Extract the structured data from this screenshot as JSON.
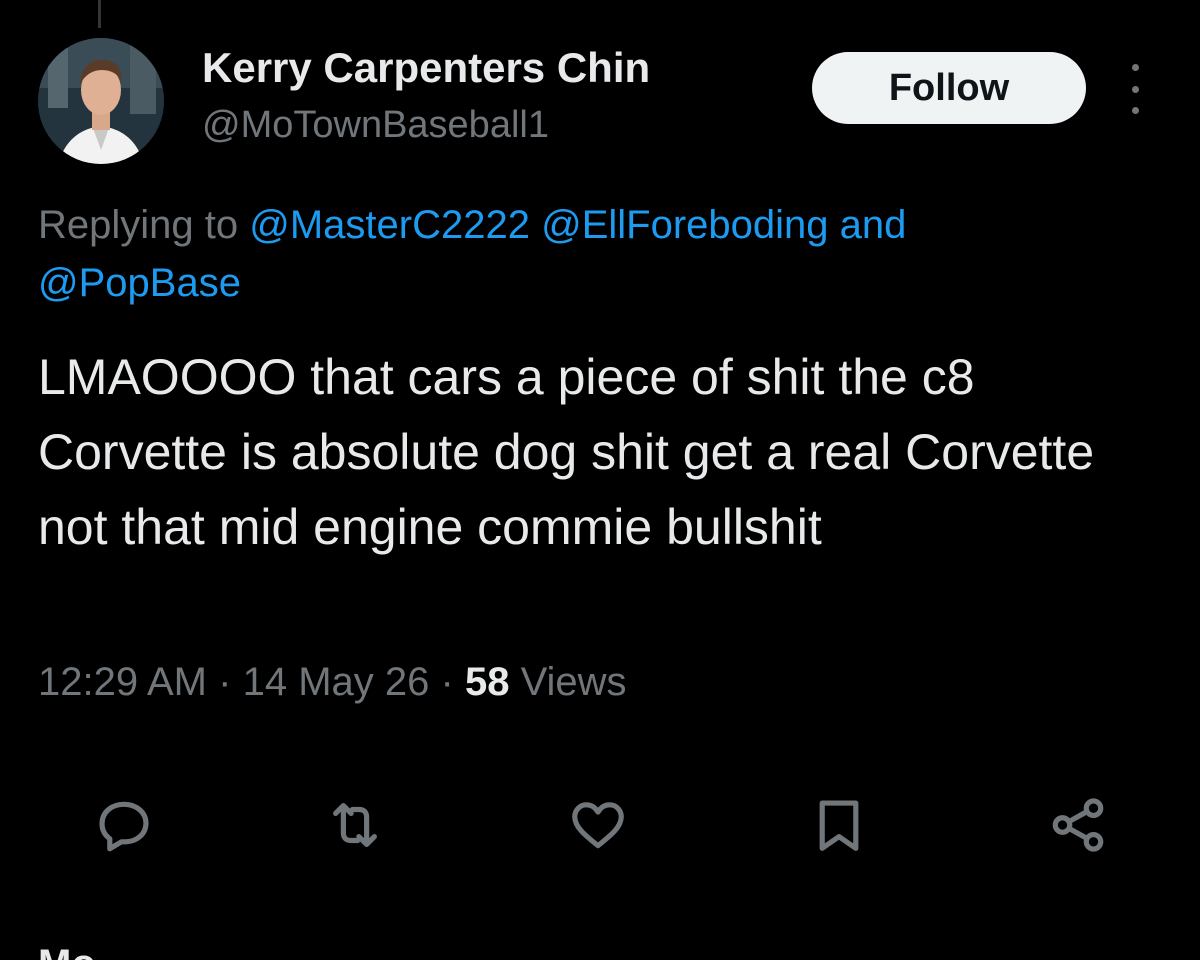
{
  "author": {
    "display_name": "Kerry Carpenters Chin",
    "handle": "@MoTownBaseball1",
    "avatar": "profile-avatar"
  },
  "follow_label": "Follow",
  "more_icon": "more-vertical-icon",
  "replying": {
    "prefix": "Replying to",
    "mention1": "@MasterC2222",
    "mention2": "@EllForeboding",
    "conjunction": "and",
    "mention3": "@PopBase"
  },
  "tweet": {
    "text": "LMAOOOO that cars a piece of shit the c8 Corvette is absolute dog shit get a real Corvette not that mid engine commie bullshit"
  },
  "meta": {
    "time": "12:29 AM",
    "sep1": "·",
    "date": "14 May 26",
    "sep2": "·",
    "views_count": "58",
    "views_label": "Views"
  },
  "actions": {
    "reply_icon": "reply-icon",
    "retweet_icon": "retweet-icon",
    "like_icon": "like-icon",
    "bookmark_icon": "bookmark-icon",
    "share_icon": "share-icon"
  },
  "bottom_partial_text": "Mo...",
  "colors": {
    "background": "#000000",
    "text": "#e7e9ea",
    "secondary": "#71767b",
    "link": "#1d9bf0",
    "follow_bg": "#eff3f4"
  }
}
